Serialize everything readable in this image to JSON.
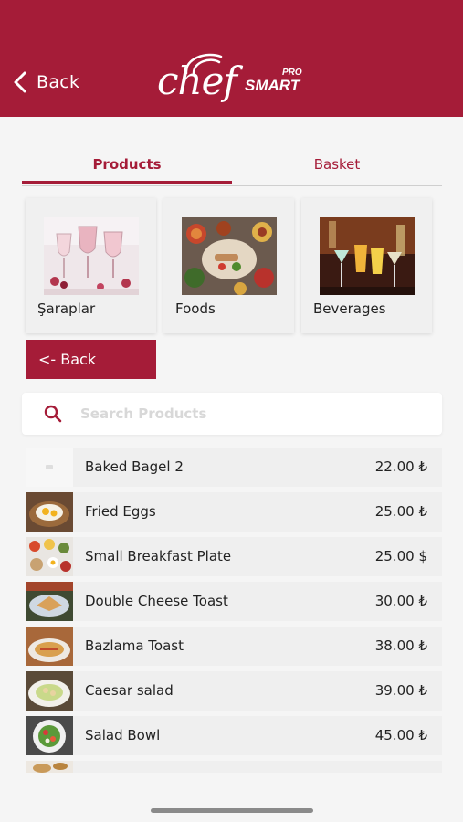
{
  "header": {
    "back_label": "Back",
    "logo": {
      "word": "chef",
      "smart": "SMART",
      "pro": "PRO"
    },
    "color": "#a51c38"
  },
  "tabs": [
    {
      "label": "Products",
      "active": true
    },
    {
      "label": "Basket",
      "active": false
    }
  ],
  "categories": [
    {
      "label": "Şaraplar",
      "image": "wine-glasses-photo"
    },
    {
      "label": "Foods",
      "image": "food-platter-photo"
    },
    {
      "label": "Beverages",
      "image": "cocktails-photo"
    }
  ],
  "back_button_label": "<- Back",
  "search": {
    "placeholder": "Search Products",
    "icon": "search-icon"
  },
  "products": [
    {
      "name": "Baked Bagel 2",
      "price": "22.00 ₺"
    },
    {
      "name": "Fried Eggs",
      "price": "25.00 ₺"
    },
    {
      "name": "Small Breakfast Plate",
      "price": "25.00 $"
    },
    {
      "name": "Double Cheese Toast",
      "price": "30.00 ₺"
    },
    {
      "name": "Bazlama Toast",
      "price": "38.00 ₺"
    },
    {
      "name": "Caesar salad",
      "price": "39.00 ₺"
    },
    {
      "name": "Salad Bowl",
      "price": "45.00 ₺"
    }
  ]
}
